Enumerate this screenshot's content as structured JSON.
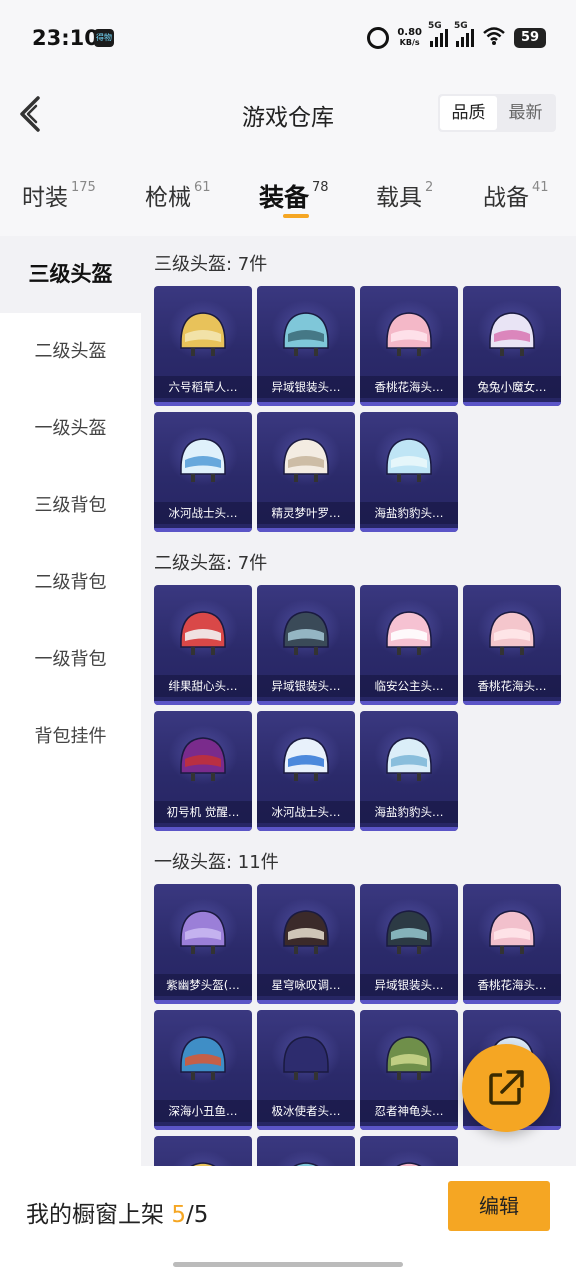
{
  "status_bar": {
    "time": "23:10",
    "app_icon_label": "得物",
    "net_speed": "0.80",
    "net_unit": "KB/s",
    "signal1": "5G",
    "signal2": "5G",
    "battery": "59"
  },
  "header": {
    "title": "游戏仓库",
    "sort_quality": "品质",
    "sort_latest": "最新"
  },
  "tabs": [
    {
      "label": "时装",
      "count": "175"
    },
    {
      "label": "枪械",
      "count": "61"
    },
    {
      "label": "装备",
      "count": "78"
    },
    {
      "label": "载具",
      "count": "2"
    },
    {
      "label": "战备",
      "count": "41"
    }
  ],
  "sidebar": [
    "三级头盔",
    "二级头盔",
    "一级头盔",
    "三级背包",
    "二级背包",
    "一级背包",
    "背包挂件"
  ],
  "sections": [
    {
      "title": "三级头盔: 7件",
      "items": [
        "六号稻草人…",
        "异域银装头…",
        "香桃花海头…",
        "兔兔小魔女…",
        "冰河战士头…",
        "精灵梦叶罗…",
        "海盐豹豹头…"
      ]
    },
    {
      "title": "二级头盔: 7件",
      "items": [
        "绯果甜心头…",
        "异域银装头…",
        "临安公主头…",
        "香桃花海头…",
        "初号机 觉醒…",
        "冰河战士头…",
        "海盐豹豹头…"
      ]
    },
    {
      "title": "一级头盔: 11件",
      "items": [
        "紫幽梦头盔(…",
        "星穹咏叹调…",
        "异域银装头…",
        "香桃花海头…",
        "深海小丑鱼…",
        "极冰使者头…",
        "忍者神龟头…",
        "",
        "",
        "",
        ""
      ]
    }
  ],
  "bottom": {
    "shelf_label": "我的橱窗上架 ",
    "shelf_count": "5",
    "shelf_total": "/5",
    "edit": "编辑"
  },
  "colors": {
    "accent": "#f5a623",
    "card_bg": "#2b2a6a"
  },
  "icons": {
    "back": "back-arrow-icon",
    "share": "share-out-icon",
    "alarm": "alarm-icon",
    "wifi": "wifi-icon"
  }
}
